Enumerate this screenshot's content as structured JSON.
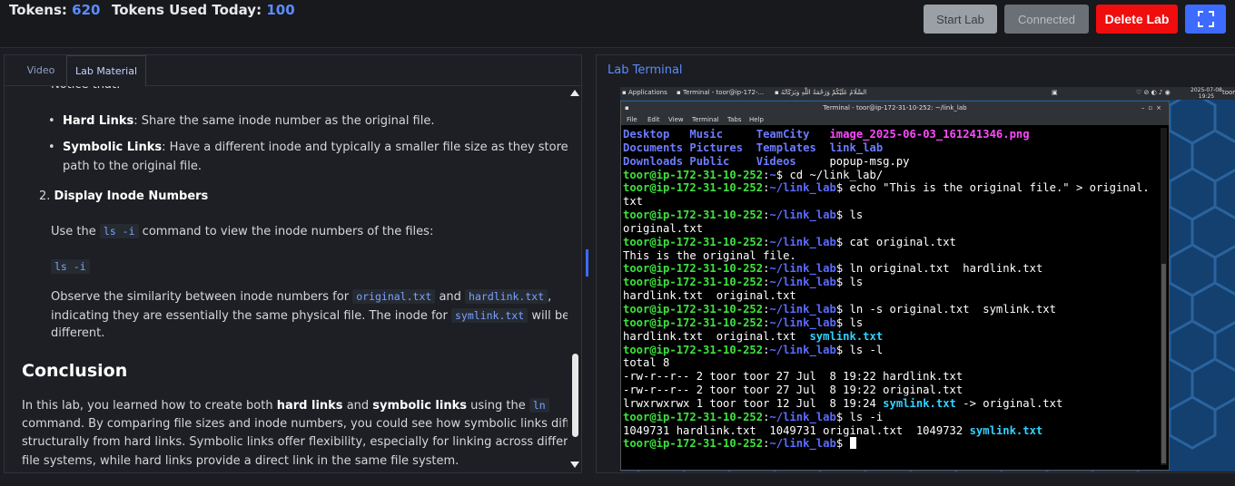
{
  "header": {
    "tokens_label": "Tokens:",
    "tokens_value": "620",
    "used_label": "Tokens Used Today:",
    "used_value": "100",
    "buttons": {
      "start": "Start Lab",
      "connected": "Connected",
      "delete": "Delete Lab",
      "fullscreen_icon": "fullscreen-icon"
    }
  },
  "left": {
    "tabs": [
      "Video",
      "Lab Material"
    ],
    "cut_line": "Notice that:",
    "bullets": [
      {
        "bold": "Hard Links",
        "text": ": Share the same inode number as the original file."
      },
      {
        "bold": "Symbolic Links",
        "text": ": Have a different inode and typically a smaller file size as they store only the",
        "text2": "path to the original file."
      }
    ],
    "step2_num": "2.",
    "step2_title": "Display Inode Numbers",
    "use_pre": "Use the",
    "use_code": "ls -i",
    "use_post": "command to view the inode numbers of the files:",
    "code_block": "ls -i",
    "observe_1": "Observe the similarity between inode numbers for",
    "observe_code1": "original.txt",
    "observe_and": "and",
    "observe_code2": "hardlink.txt",
    "observe_comma": ",",
    "observe_2": "indicating they are essentially the same physical file. The inode for",
    "observe_code3": "symlink.txt",
    "observe_3": "will be",
    "observe_4": "different.",
    "conclusion_title": "Conclusion",
    "para1_a": "In this lab, you learned how to create both",
    "para1_b": "hard links",
    "para1_c": "and",
    "para1_d": "symbolic links",
    "para1_e": "using the",
    "para1_code": "ln",
    "para2": "command. By comparing file sizes and inode numbers, you could see how symbolic links differ",
    "para3": "structurally from hard links. Symbolic links offer flexibility, especially for linking across different",
    "para4": "file systems, while hard links provide a direct link in the same file system."
  },
  "right": {
    "title": "Lab Terminal",
    "sysbar": {
      "apps": "Applications",
      "task1": "Terminal - toor@ip-172-...",
      "task2": "السَّلَامُ عَلَيْكُمْ وَرَحْمَةُ اللَّهِ وَبَرَكَاتُهُ",
      "date": "2025-07-08",
      "time": "19:25",
      "user": "toor"
    },
    "terminal_title": "Terminal - toor@ip-172-31-10-252: ~/link_lab",
    "menu": [
      "File",
      "Edit",
      "View",
      "Terminal",
      "Tabs",
      "Help"
    ],
    "prompt_user": "toor@ip-172-31-10-252",
    "prompt_sep": ":",
    "lines": [
      {
        "type": "ls3",
        "a": "Desktop",
        "b": "Music",
        "c": "TeamCity",
        "d": "image_2025-06-03_161241346.png"
      },
      {
        "type": "ls3",
        "a": "Documents",
        "b": "Pictures",
        "c": "Templates",
        "d": "link_lab"
      },
      {
        "type": "ls3",
        "a": "Downloads",
        "b": "Public",
        "c": "Videos",
        "d": "popup-msg.py"
      },
      {
        "type": "cmd",
        "path": "~",
        "cmd": "cd ~/link_lab/"
      },
      {
        "type": "cmd",
        "path": "~/link_lab",
        "cmd": "echo \"This is the original file.\" > original."
      },
      {
        "type": "out",
        "text": "txt"
      },
      {
        "type": "cmd",
        "path": "~/link_lab",
        "cmd": "ls"
      },
      {
        "type": "out",
        "text": "original.txt"
      },
      {
        "type": "cmd",
        "path": "~/link_lab",
        "cmd": "cat original.txt"
      },
      {
        "type": "out",
        "text": "This is the original file."
      },
      {
        "type": "cmd",
        "path": "~/link_lab",
        "cmd": "ln original.txt  hardlink.txt"
      },
      {
        "type": "cmd",
        "path": "~/link_lab",
        "cmd": "ls"
      },
      {
        "type": "out",
        "text": "hardlink.txt  original.txt"
      },
      {
        "type": "cmd",
        "path": "~/link_lab",
        "cmd": "ln -s original.txt  symlink.txt"
      },
      {
        "type": "cmd",
        "path": "~/link_lab",
        "cmd": "ls"
      },
      {
        "type": "lsy",
        "text": "hardlink.txt  original.txt  ",
        "link": "symlink.txt"
      },
      {
        "type": "cmd",
        "path": "~/link_lab",
        "cmd": "ls -l"
      },
      {
        "type": "out",
        "text": "total 8"
      },
      {
        "type": "out",
        "text": "-rw-r--r-- 2 toor toor 27 Jul  8 19:22 hardlink.txt"
      },
      {
        "type": "out",
        "text": "-rw-r--r-- 2 toor toor 27 Jul  8 19:22 original.txt"
      },
      {
        "type": "lsl",
        "text": "lrwxrwxrwx 1 toor toor 12 Jul  8 19:24 ",
        "link": "symlink.txt",
        "tail": " -> original.txt"
      },
      {
        "type": "cmd",
        "path": "~/link_lab",
        "cmd": "ls -i"
      },
      {
        "type": "lsy",
        "text": "1049731 hardlink.txt  1049731 original.txt  1049732 ",
        "link": "symlink.txt"
      },
      {
        "type": "prompt",
        "path": "~/link_lab"
      }
    ]
  },
  "colors": {
    "accent": "#3d6bff",
    "danger": "#f00d0d",
    "prompt": "#3ee23e",
    "dir": "#5b6cff",
    "link": "#2fd3ff",
    "image": "#ff49ff"
  }
}
